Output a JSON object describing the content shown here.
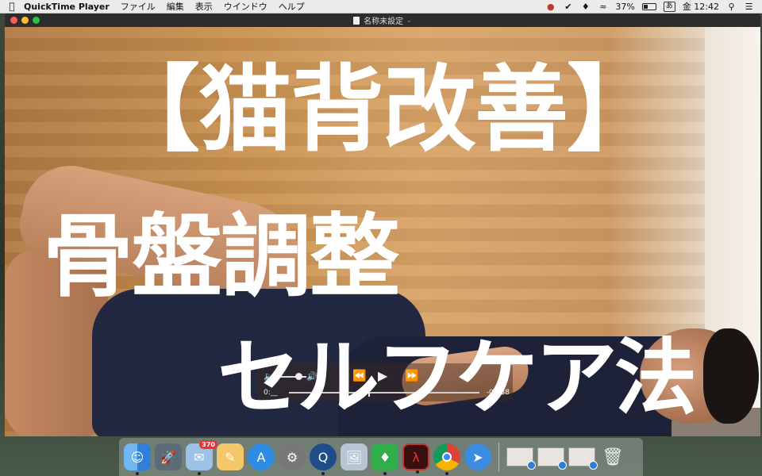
{
  "menubar": {
    "app_name": "QuickTime Player",
    "menus": [
      "ファイル",
      "編集",
      "表示",
      "ウインドウ",
      "ヘルプ"
    ],
    "battery_percent": "37%",
    "battery_level": 0.37,
    "ime_label": "あ",
    "clock": "金 12:42"
  },
  "window": {
    "title": "名称未設定"
  },
  "captions": {
    "line1": "【猫背改善】",
    "line2": "骨盤調整",
    "line3": "セルフケア法"
  },
  "playback": {
    "current_time": "0:__",
    "remaining_time": "-03:38"
  },
  "dock": {
    "items": [
      {
        "name": "Finder",
        "icon": "finder-icon",
        "running": true
      },
      {
        "name": "Launchpad",
        "icon": "launchpad-icon",
        "running": false
      },
      {
        "name": "Mail",
        "icon": "mail-icon",
        "badge": "370",
        "running": true
      },
      {
        "name": "Notes",
        "icon": "notes-icon",
        "running": false
      },
      {
        "name": "App Store",
        "icon": "app-store-icon",
        "running": false
      },
      {
        "name": "System Preferences",
        "icon": "system-preferences-icon",
        "running": false
      },
      {
        "name": "QuickTime Player",
        "icon": "quicktime-icon",
        "running": true
      },
      {
        "name": "Preview",
        "icon": "preview-icon",
        "running": false
      },
      {
        "name": "Evernote",
        "icon": "evernote-icon",
        "running": true
      },
      {
        "name": "Acrobat",
        "icon": "acrobat-icon",
        "running": true
      },
      {
        "name": "Chrome",
        "icon": "chrome-icon",
        "running": true
      },
      {
        "name": "Safari",
        "icon": "safari-icon",
        "running": false
      }
    ],
    "trash_label": "Trash"
  }
}
